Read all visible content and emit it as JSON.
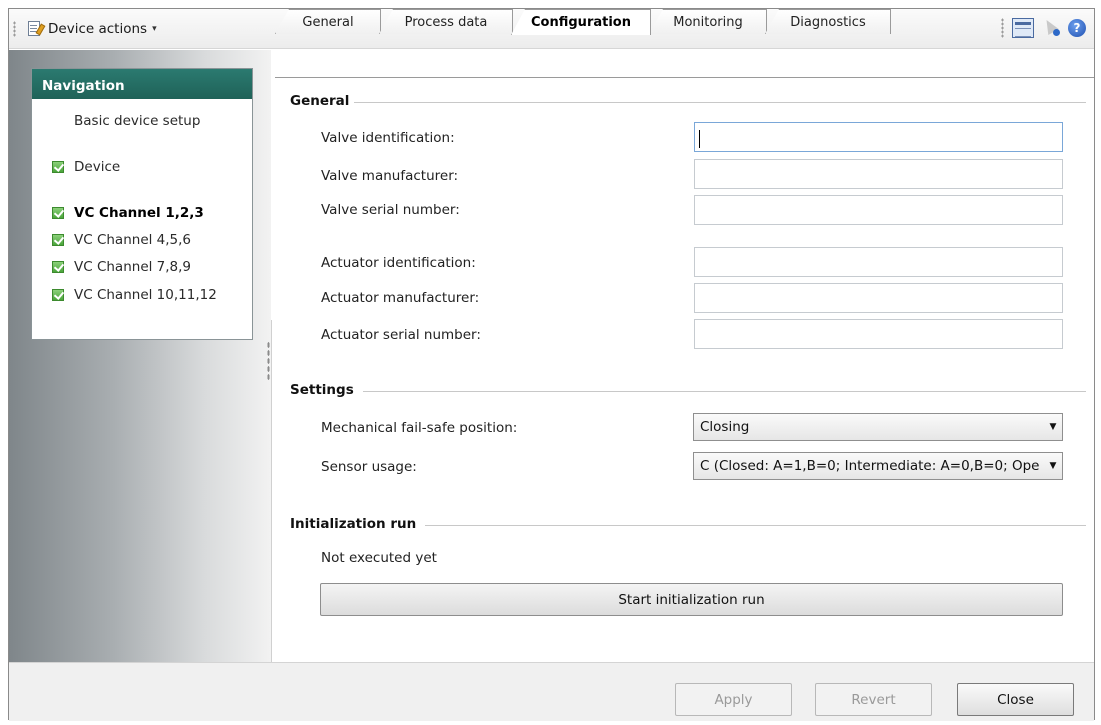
{
  "toolbar": {
    "device_actions_label": "Device actions",
    "device_actions_caret": "▾",
    "icons": [
      "document-edit-icon",
      "layout-icon",
      "pointer-help-icon",
      "help-icon"
    ],
    "help_glyph": "?"
  },
  "navigation": {
    "header": "Navigation",
    "items": [
      {
        "label": "Basic device setup",
        "checked": false,
        "bold": false
      },
      {
        "label": "Device",
        "checked": true,
        "bold": false
      },
      {
        "label": "VC Channel 1,2,3",
        "checked": true,
        "bold": true
      },
      {
        "label": "VC Channel 4,5,6",
        "checked": true,
        "bold": false
      },
      {
        "label": "VC Channel 7,8,9",
        "checked": true,
        "bold": false
      },
      {
        "label": "VC Channel 10,11,12",
        "checked": true,
        "bold": false
      }
    ]
  },
  "tabs": [
    {
      "label": "General",
      "active": false
    },
    {
      "label": "Process data",
      "active": false
    },
    {
      "label": "Configuration",
      "active": true
    },
    {
      "label": "Monitoring",
      "active": false
    },
    {
      "label": "Diagnostics",
      "active": false
    }
  ],
  "general": {
    "title": "General",
    "fields": [
      {
        "label": "Valve identification:",
        "value": ""
      },
      {
        "label": "Valve manufacturer:",
        "value": ""
      },
      {
        "label": "Valve serial number:",
        "value": ""
      },
      {
        "label": "Actuator identification:",
        "value": ""
      },
      {
        "label": "Actuator manufacturer:",
        "value": ""
      },
      {
        "label": "Actuator serial number:",
        "value": ""
      }
    ]
  },
  "settings": {
    "title": "Settings",
    "fail_safe_label": "Mechanical fail-safe position:",
    "fail_safe_value": "Closing",
    "sensor_usage_label": "Sensor usage:",
    "sensor_usage_value": "C (Closed: A=1,B=0; Intermediate: A=0,B=0; Ope"
  },
  "initialization": {
    "title": "Initialization run",
    "status": "Not executed yet",
    "button_label": "Start initialization run"
  },
  "footer": {
    "apply_label": "Apply",
    "revert_label": "Revert",
    "close_label": "Close"
  },
  "colors": {
    "nav_header": "#1f6258",
    "check_green": "#4aa53a",
    "help_blue": "#1d4fb0"
  }
}
